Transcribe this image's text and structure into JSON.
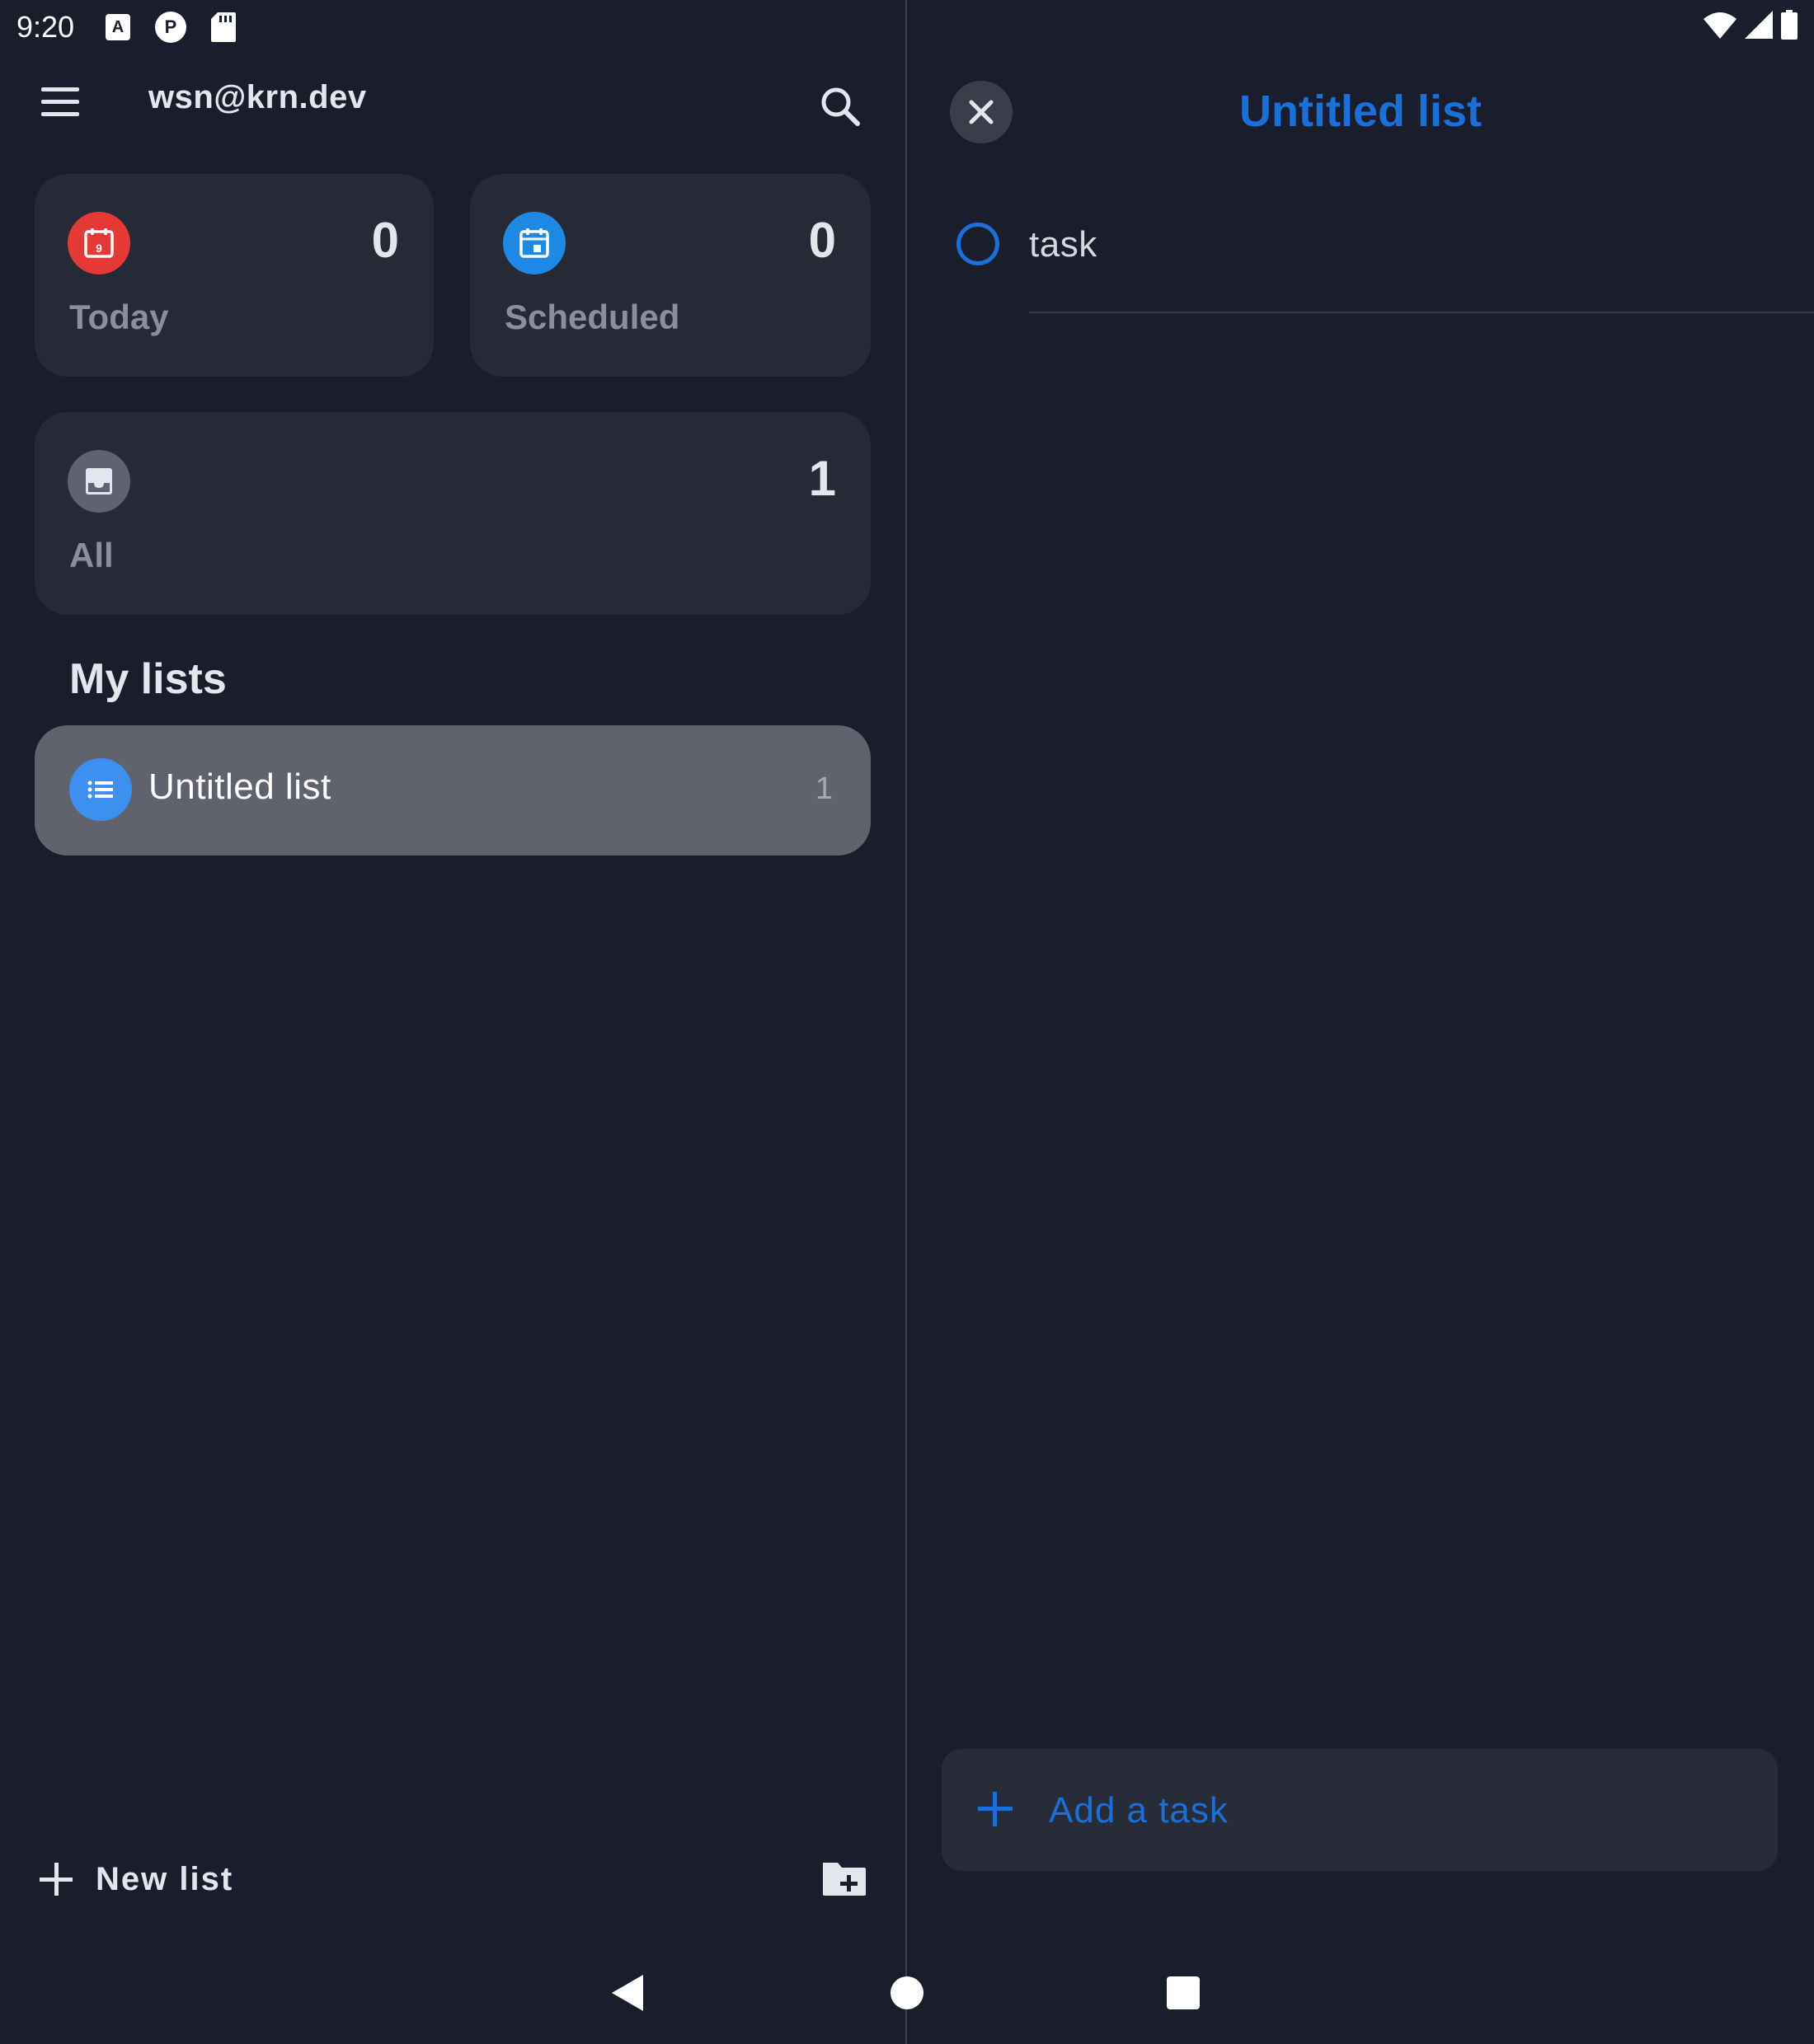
{
  "status_bar": {
    "time": "9:20",
    "left_icons": [
      "font-a-icon",
      "pocket-casts-icon",
      "sd-card-icon"
    ],
    "right_icons": [
      "wifi-icon",
      "cell-signal-icon",
      "battery-icon"
    ]
  },
  "left": {
    "account": "wsn@krn.dev",
    "smart_lists": [
      {
        "label": "Today",
        "count": "0",
        "icon": "calendar-today-icon",
        "color": "#e53935",
        "badge": "9"
      },
      {
        "label": "Scheduled",
        "count": "0",
        "icon": "calendar-scheduled-icon",
        "color": "#1e88e5"
      },
      {
        "label": "All",
        "count": "1",
        "icon": "inbox-icon",
        "color": "#5f6270"
      }
    ],
    "my_lists_title": "My lists",
    "lists": [
      {
        "label": "Untitled list",
        "count": "1",
        "icon": "list-icon",
        "color": "#3d8ff0"
      }
    ],
    "new_list_label": "New list"
  },
  "right": {
    "title": "Untitled list",
    "tasks": [
      {
        "label": "task",
        "done": false
      }
    ],
    "add_task_label": "Add a task",
    "accent": "#1a6fd8"
  }
}
